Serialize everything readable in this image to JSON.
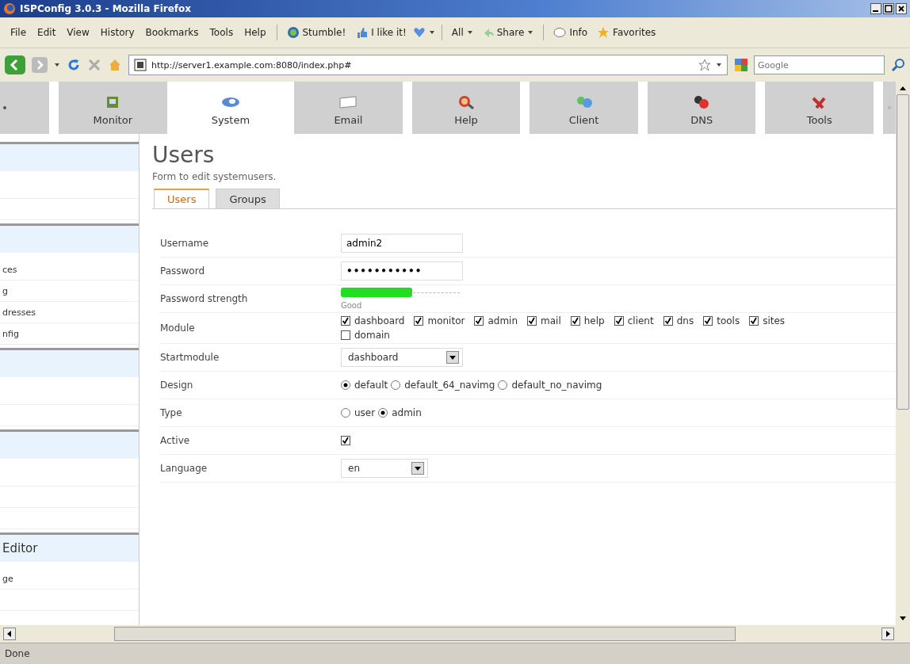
{
  "window": {
    "title": "ISPConfig 3.0.3 - Mozilla Firefox"
  },
  "menu": [
    "File",
    "Edit",
    "View",
    "History",
    "Bookmarks",
    "Tools",
    "Help"
  ],
  "toolbar": [
    {
      "kind": "button",
      "label": "Stumble!"
    },
    {
      "kind": "button",
      "label": "I like it!"
    },
    {
      "kind": "dropdown",
      "label": "All"
    },
    {
      "kind": "dropdown",
      "label": "Share"
    },
    {
      "kind": "button",
      "label": "Info"
    },
    {
      "kind": "button",
      "label": "Favorites"
    }
  ],
  "address": {
    "value": "http://server1.example.com:8080/index.php#"
  },
  "search": {
    "placeholder": "Google"
  },
  "modules": [
    {
      "label": "Monitor",
      "selected": false
    },
    {
      "label": "System",
      "selected": true
    },
    {
      "label": "Email",
      "selected": false
    },
    {
      "label": "Help",
      "selected": false
    },
    {
      "label": "Client",
      "selected": false
    },
    {
      "label": "DNS",
      "selected": false
    },
    {
      "label": "Tools",
      "selected": false
    }
  ],
  "sidebar": {
    "sections": [
      {
        "kind": "blank"
      },
      {
        "kind": "list",
        "items": [
          "ces",
          "g",
          "dresses",
          "nfig"
        ]
      },
      {
        "kind": "blank"
      },
      {
        "kind": "blank3"
      },
      {
        "kind": "list",
        "header": "Editor",
        "items": [
          "ge"
        ]
      }
    ]
  },
  "page": {
    "title": "Users",
    "subtitle": "Form to edit systemusers.",
    "tabs": [
      {
        "label": "Users",
        "selected": true
      },
      {
        "label": "Groups",
        "selected": false
      }
    ]
  },
  "form": [
    {
      "kind": "text",
      "label": "Username",
      "value": "admin2"
    },
    {
      "kind": "password",
      "label": "Password",
      "value": "•••••••••••"
    },
    {
      "kind": "strength",
      "label": "Password strength",
      "level": 0.6,
      "reading": "Good"
    },
    {
      "kind": "checks",
      "label": "Module",
      "options": [
        {
          "label": "dashboard",
          "checked": true
        },
        {
          "label": "monitor",
          "checked": true
        },
        {
          "label": "admin",
          "checked": true
        },
        {
          "label": "mail",
          "checked": true
        },
        {
          "label": "help",
          "checked": true
        },
        {
          "label": "client",
          "checked": true
        },
        {
          "label": "dns",
          "checked": true
        },
        {
          "label": "tools",
          "checked": true
        },
        {
          "label": "sites",
          "checked": true
        },
        {
          "label": "domain",
          "checked": false
        }
      ]
    },
    {
      "kind": "select",
      "label": "Startmodule",
      "value": "dashboard"
    },
    {
      "kind": "radios",
      "label": "Design",
      "options": [
        {
          "label": "default",
          "selected": true
        },
        {
          "label": "default_64_navimg",
          "selected": false
        },
        {
          "label": "default_no_navimg",
          "selected": false
        }
      ]
    },
    {
      "kind": "radios",
      "label": "Type",
      "options": [
        {
          "label": "user",
          "selected": false
        },
        {
          "label": "admin",
          "selected": true
        }
      ]
    },
    {
      "kind": "check",
      "label": "Active",
      "checked": true
    },
    {
      "kind": "select",
      "label": "Language",
      "value": "en"
    }
  ],
  "status_bar": "Done"
}
